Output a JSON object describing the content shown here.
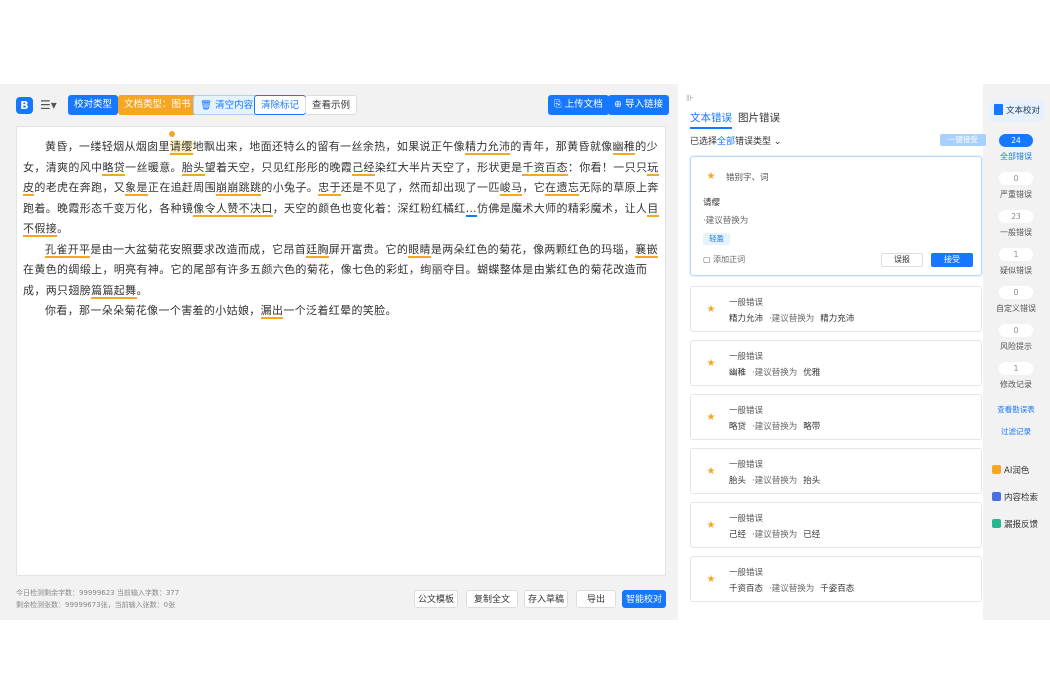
{
  "toolbar": {
    "proofread_type": "校对类型",
    "doc_type": "文档类型：图书",
    "clear_content": "清空内容",
    "clear_marks": "清除标记",
    "view_example": "查看示例",
    "upload_doc": "上传文档",
    "import_link": "导入链接",
    "logo": "B"
  },
  "editor": {
    "paragraphs": [
      [
        "黄昏，一缕轻烟从烟囱里",
        {
          "err": "请缨",
          "active": true
        },
        "地飘出来，地面还特么的留有一丝余热，如果说正午像",
        {
          "err": "精力允沛"
        },
        "的青年，那黄昏就像",
        {
          "err": "幽稚"
        },
        "的少女，清爽的风中",
        {
          "err": "略贷"
        },
        "一丝暖意。",
        {
          "err": "胎头"
        },
        "望着天空，只见红彤彤的晚霞",
        {
          "err": "己经"
        },
        "染红大半片天空了，形状更是",
        {
          "err": "千资百态"
        },
        "：你看！一只只",
        {
          "err": "玩皮"
        },
        "的老虎在奔跑，又",
        {
          "err": "象是"
        },
        "正在追赶周围",
        {
          "err": "崩崩跳跳"
        },
        "的小兔子。",
        {
          "err": "忠于"
        },
        "还是不见了，然而却出现了一匹",
        {
          "err": "峻马"
        },
        "，它",
        {
          "err": "在遗忘"
        },
        "无际的草原上奔跑着。晚霞形态千变万化，各种镜",
        {
          "err": "像令人赞不决口"
        },
        "，天空的颜色也变化着：深红粉红橘红",
        {
          "err": "…",
          "blue": true
        },
        "仿佛是魔术大师的精彩魔术，让人",
        {
          "err": "目不假接"
        },
        "。"
      ],
      [
        {
          "err": "孔雀开平"
        },
        "是由一大盆菊花安照要求改造而成，它昂首",
        {
          "err": "廷胸"
        },
        "屏开富贵。它的",
        {
          "err": "眼睛"
        },
        "是两朵红色的菊花，像两颗红色的玛瑙，",
        {
          "err": "襄嵌"
        },
        "在黄色的绸缎上，明亮有神。它的尾部有许多五颜六色的菊花，像七色的彩虹，绚丽夺目。蝴蝶整体是由紫红色的菊花改造而成，两只翅膀",
        {
          "err": "篇篇起舞"
        },
        "。"
      ],
      [
        "你看，那一朵朵菊花像一个害羞的小姑娘，",
        {
          "err": "漏出"
        },
        "一个泛着红晕的笑脸。"
      ]
    ]
  },
  "footer": {
    "stat1": "今日检测剩余字数：99999623    当前输入字数：377",
    "stat2": "剩余检测张数：99999673张，当前输入张数：0张",
    "template": "公文模板",
    "copy_all": "复制全文",
    "save_draft": "存入草稿",
    "export": "导出",
    "smart_proofread": "智能校对"
  },
  "results": {
    "tab_text": "文本错误",
    "tab_image": "图片错误",
    "filter_prefix": "已选择",
    "filter_all": "全部",
    "filter_suffix": "错误类型",
    "accept_all": "一键接受",
    "main_card": {
      "category": "错别字、词",
      "word": "请缨",
      "hint": "·建议替换为",
      "suggestion": "轻盈",
      "add_word": "添加正词",
      "misreport": "误报",
      "accept": "接受"
    },
    "cards": [
      {
        "category": "一般错误",
        "word": "精力允沛",
        "hint": "·建议替换为",
        "suggestion": "精力充沛"
      },
      {
        "category": "一般错误",
        "word": "幽稚",
        "hint": "·建议替换为",
        "suggestion": "优雅"
      },
      {
        "category": "一般错误",
        "word": "略贷",
        "hint": "·建议替换为",
        "suggestion": "略带"
      },
      {
        "category": "一般错误",
        "word": "胎头",
        "hint": "·建议替换为",
        "suggestion": "抬头"
      },
      {
        "category": "一般错误",
        "word": "己经",
        "hint": "·建议替换为",
        "suggestion": "已经"
      },
      {
        "category": "一般错误",
        "word": "千资百态",
        "hint": "·建议替换为",
        "suggestion": "千姿百态"
      }
    ]
  },
  "sidebar": {
    "text_proofread": "文本校对",
    "counts": [
      {
        "value": "24",
        "label": "全部错误"
      },
      {
        "value": "0",
        "label": "严重错误"
      },
      {
        "value": "23",
        "label": "一般错误"
      },
      {
        "value": "1",
        "label": "疑似错误"
      },
      {
        "value": "0",
        "label": "自定义错误"
      },
      {
        "value": "0",
        "label": "风险提示"
      },
      {
        "value": "1",
        "label": "修改记录"
      }
    ],
    "view_proofread_table": "查看勘误表",
    "filter_records": "过滤记录",
    "ai_polish": "AI润色",
    "content_search": "内容检索",
    "report_feedback": "漏报反馈"
  },
  "colors": {
    "primary": "#1677ff",
    "warning": "#f6a623",
    "background": "#f2f2f2"
  },
  "icons": [
    "logo-icon",
    "menu-icon",
    "trash-icon",
    "upload-icon",
    "link-icon",
    "star-icon",
    "add-word-icon",
    "chevron-down-icon",
    "collapse-icon",
    "doc-icon",
    "ai-icon",
    "search-icon",
    "feedback-icon"
  ]
}
